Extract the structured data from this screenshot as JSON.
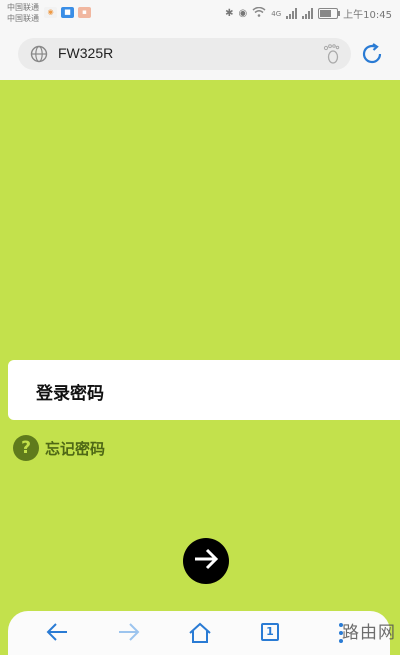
{
  "status_bar": {
    "carrier_1": "中国联通",
    "carrier_2": "中国联通",
    "network": "4G",
    "time": "上午10:45"
  },
  "address_bar": {
    "url": "FW325R"
  },
  "login": {
    "password_label": "登录密码",
    "forgot_label": "忘记密码"
  },
  "toolbar": {
    "tab_count": "1"
  },
  "watermark": "路由网",
  "colors": {
    "background": "#c3e14c",
    "accent_blue": "#2a7bd4"
  }
}
